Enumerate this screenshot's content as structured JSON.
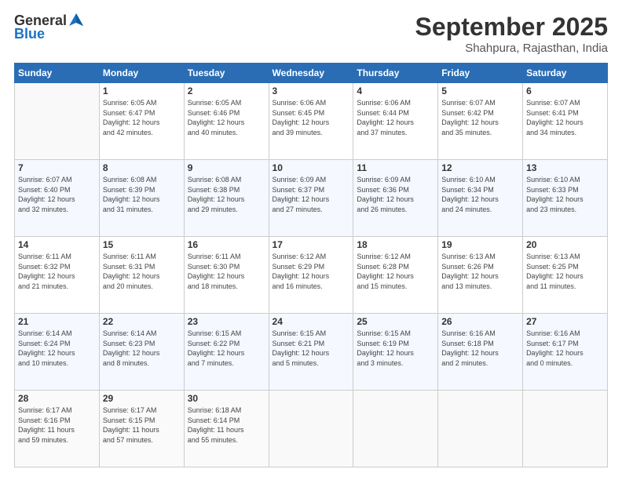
{
  "header": {
    "logo_general": "General",
    "logo_blue": "Blue",
    "month": "September 2025",
    "location": "Shahpura, Rajasthan, India"
  },
  "weekdays": [
    "Sunday",
    "Monday",
    "Tuesday",
    "Wednesday",
    "Thursday",
    "Friday",
    "Saturday"
  ],
  "weeks": [
    [
      {
        "day": "",
        "info": ""
      },
      {
        "day": "1",
        "info": "Sunrise: 6:05 AM\nSunset: 6:47 PM\nDaylight: 12 hours\nand 42 minutes."
      },
      {
        "day": "2",
        "info": "Sunrise: 6:05 AM\nSunset: 6:46 PM\nDaylight: 12 hours\nand 40 minutes."
      },
      {
        "day": "3",
        "info": "Sunrise: 6:06 AM\nSunset: 6:45 PM\nDaylight: 12 hours\nand 39 minutes."
      },
      {
        "day": "4",
        "info": "Sunrise: 6:06 AM\nSunset: 6:44 PM\nDaylight: 12 hours\nand 37 minutes."
      },
      {
        "day": "5",
        "info": "Sunrise: 6:07 AM\nSunset: 6:42 PM\nDaylight: 12 hours\nand 35 minutes."
      },
      {
        "day": "6",
        "info": "Sunrise: 6:07 AM\nSunset: 6:41 PM\nDaylight: 12 hours\nand 34 minutes."
      }
    ],
    [
      {
        "day": "7",
        "info": "Sunrise: 6:07 AM\nSunset: 6:40 PM\nDaylight: 12 hours\nand 32 minutes."
      },
      {
        "day": "8",
        "info": "Sunrise: 6:08 AM\nSunset: 6:39 PM\nDaylight: 12 hours\nand 31 minutes."
      },
      {
        "day": "9",
        "info": "Sunrise: 6:08 AM\nSunset: 6:38 PM\nDaylight: 12 hours\nand 29 minutes."
      },
      {
        "day": "10",
        "info": "Sunrise: 6:09 AM\nSunset: 6:37 PM\nDaylight: 12 hours\nand 27 minutes."
      },
      {
        "day": "11",
        "info": "Sunrise: 6:09 AM\nSunset: 6:36 PM\nDaylight: 12 hours\nand 26 minutes."
      },
      {
        "day": "12",
        "info": "Sunrise: 6:10 AM\nSunset: 6:34 PM\nDaylight: 12 hours\nand 24 minutes."
      },
      {
        "day": "13",
        "info": "Sunrise: 6:10 AM\nSunset: 6:33 PM\nDaylight: 12 hours\nand 23 minutes."
      }
    ],
    [
      {
        "day": "14",
        "info": "Sunrise: 6:11 AM\nSunset: 6:32 PM\nDaylight: 12 hours\nand 21 minutes."
      },
      {
        "day": "15",
        "info": "Sunrise: 6:11 AM\nSunset: 6:31 PM\nDaylight: 12 hours\nand 20 minutes."
      },
      {
        "day": "16",
        "info": "Sunrise: 6:11 AM\nSunset: 6:30 PM\nDaylight: 12 hours\nand 18 minutes."
      },
      {
        "day": "17",
        "info": "Sunrise: 6:12 AM\nSunset: 6:29 PM\nDaylight: 12 hours\nand 16 minutes."
      },
      {
        "day": "18",
        "info": "Sunrise: 6:12 AM\nSunset: 6:28 PM\nDaylight: 12 hours\nand 15 minutes."
      },
      {
        "day": "19",
        "info": "Sunrise: 6:13 AM\nSunset: 6:26 PM\nDaylight: 12 hours\nand 13 minutes."
      },
      {
        "day": "20",
        "info": "Sunrise: 6:13 AM\nSunset: 6:25 PM\nDaylight: 12 hours\nand 11 minutes."
      }
    ],
    [
      {
        "day": "21",
        "info": "Sunrise: 6:14 AM\nSunset: 6:24 PM\nDaylight: 12 hours\nand 10 minutes."
      },
      {
        "day": "22",
        "info": "Sunrise: 6:14 AM\nSunset: 6:23 PM\nDaylight: 12 hours\nand 8 minutes."
      },
      {
        "day": "23",
        "info": "Sunrise: 6:15 AM\nSunset: 6:22 PM\nDaylight: 12 hours\nand 7 minutes."
      },
      {
        "day": "24",
        "info": "Sunrise: 6:15 AM\nSunset: 6:21 PM\nDaylight: 12 hours\nand 5 minutes."
      },
      {
        "day": "25",
        "info": "Sunrise: 6:15 AM\nSunset: 6:19 PM\nDaylight: 12 hours\nand 3 minutes."
      },
      {
        "day": "26",
        "info": "Sunrise: 6:16 AM\nSunset: 6:18 PM\nDaylight: 12 hours\nand 2 minutes."
      },
      {
        "day": "27",
        "info": "Sunrise: 6:16 AM\nSunset: 6:17 PM\nDaylight: 12 hours\nand 0 minutes."
      }
    ],
    [
      {
        "day": "28",
        "info": "Sunrise: 6:17 AM\nSunset: 6:16 PM\nDaylight: 11 hours\nand 59 minutes."
      },
      {
        "day": "29",
        "info": "Sunrise: 6:17 AM\nSunset: 6:15 PM\nDaylight: 11 hours\nand 57 minutes."
      },
      {
        "day": "30",
        "info": "Sunrise: 6:18 AM\nSunset: 6:14 PM\nDaylight: 11 hours\nand 55 minutes."
      },
      {
        "day": "",
        "info": ""
      },
      {
        "day": "",
        "info": ""
      },
      {
        "day": "",
        "info": ""
      },
      {
        "day": "",
        "info": ""
      }
    ]
  ]
}
